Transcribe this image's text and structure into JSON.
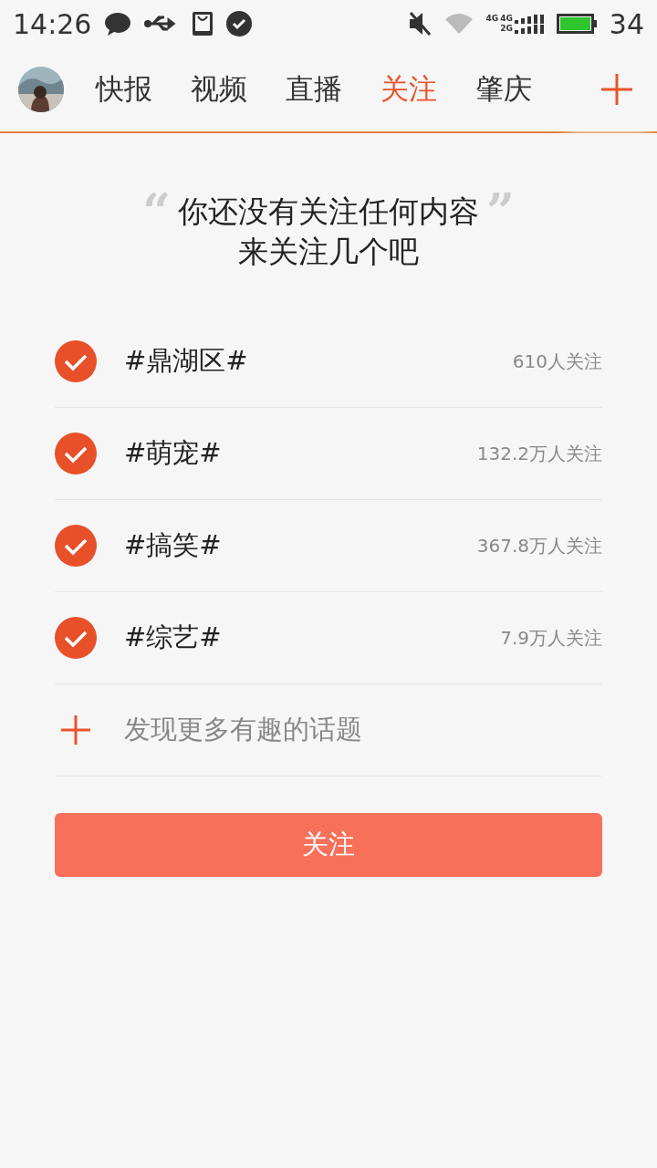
{
  "status_bar": {
    "time": "14:26",
    "network_labels": [
      "4G",
      "4G",
      "2G"
    ],
    "battery": "34"
  },
  "tabs": [
    {
      "label": "快报",
      "selected": false
    },
    {
      "label": "视频",
      "selected": false
    },
    {
      "label": "直播",
      "selected": false
    },
    {
      "label": "关注",
      "selected": true
    },
    {
      "label": "肇庆",
      "selected": false
    }
  ],
  "empty_message": {
    "open_quote": "“",
    "line_1": "你还没有关注任何内容",
    "close_quote": "”",
    "line_2": "来关注几个吧"
  },
  "topics": [
    {
      "name": "#鼎湖区#",
      "followers": "610人关注",
      "checked": true
    },
    {
      "name": "#萌宠#",
      "followers": "132.2万人关注",
      "checked": true
    },
    {
      "name": "#搞笑#",
      "followers": "367.8万人关注",
      "checked": true
    },
    {
      "name": "#综艺#",
      "followers": "7.9万人关注",
      "checked": true
    }
  ],
  "discover_more": "发现更多有趣的话题",
  "follow_button": "关注"
}
